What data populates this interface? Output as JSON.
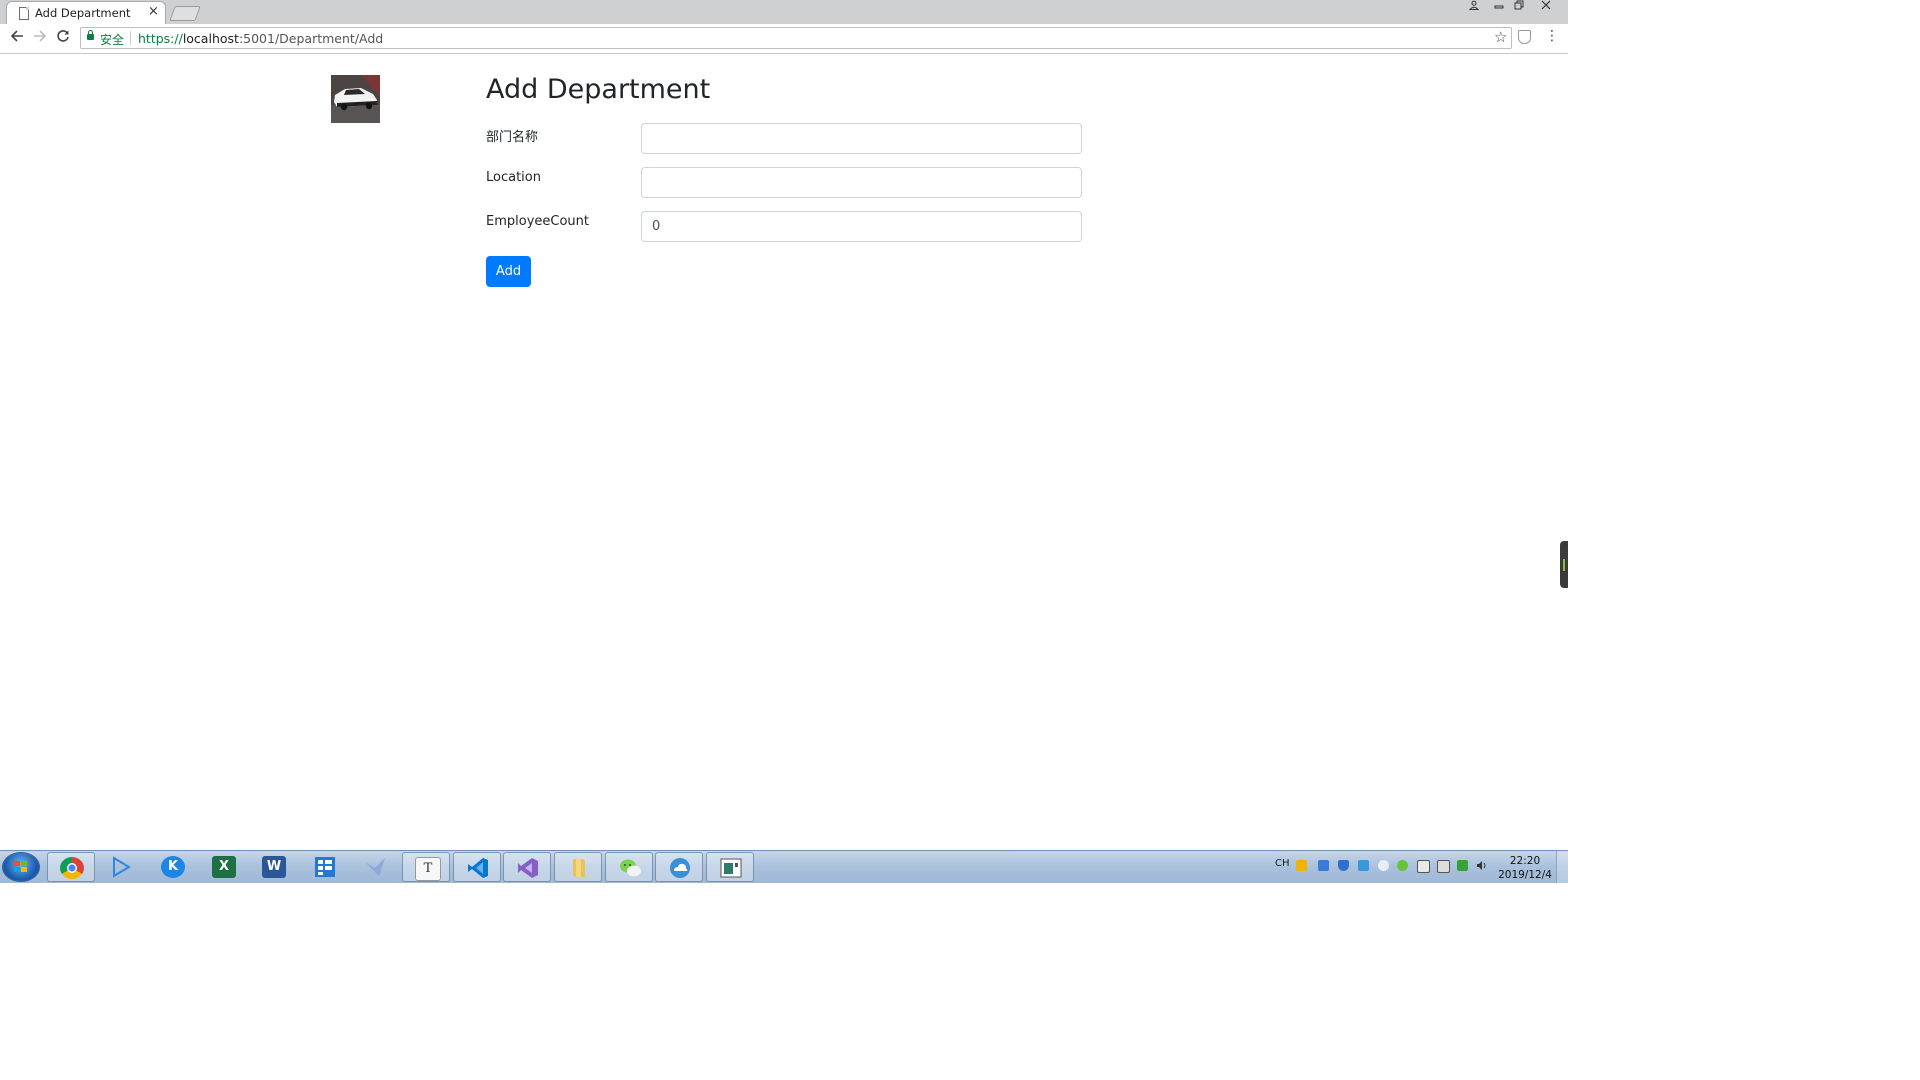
{
  "browser": {
    "tab_title": "Add Department",
    "tab_close": "×",
    "security_label": "安全",
    "url_scheme": "https://",
    "url_host": "localhost",
    "url_rest": ":5001/Department/Add",
    "star_glyph": "☆",
    "menu_glyph": "⋮"
  },
  "page": {
    "title": "Add Department",
    "fields": [
      {
        "label": "部门名称",
        "value": "",
        "placeholder": ""
      },
      {
        "label": "Location",
        "value": "",
        "placeholder": ""
      },
      {
        "label": "EmployeeCount",
        "value": "0",
        "placeholder": ""
      }
    ],
    "submit_label": "Add"
  },
  "taskbar": {
    "apps": [
      "chrome-icon",
      "media-player-icon",
      "kugou-icon",
      "excel-icon",
      "word-icon",
      "app-grid-icon",
      "bird-icon",
      "typora-icon",
      "vscode-icon",
      "visual-studio-icon",
      "file-explorer-icon",
      "wechat-icon",
      "cloud-icon",
      "window-icon"
    ],
    "language": "CH",
    "time": "22:20",
    "date": "2019/12/4"
  },
  "colors": {
    "primary": "#007bff",
    "secure_green": "#0b8043",
    "taskbar": "#a9c1dd"
  }
}
